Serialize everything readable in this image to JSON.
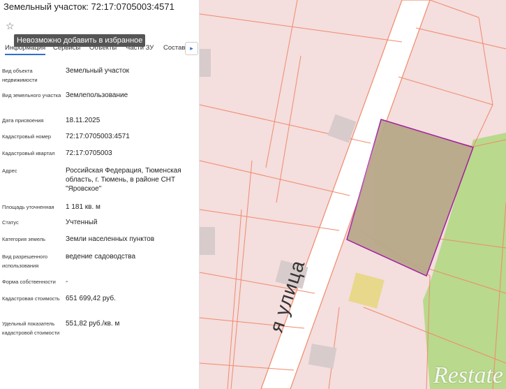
{
  "panel": {
    "title": "Земельный участок: 72:17:0705003:4571",
    "star_icon": "☆",
    "tooltip": "Невозможно добавить в избранное",
    "tabs": [
      "Информация",
      "Сервисы",
      "Объекты",
      "Части ЗУ",
      "Состав"
    ],
    "tab_next": "▸",
    "rows": [
      {
        "label": "Вид объекта недвижимости",
        "value": "Земельный участок"
      },
      {
        "label": "Вид земельного участка",
        "value": "Землепользование"
      },
      {
        "label": "Дата присвоения",
        "value": "18.11.2025"
      },
      {
        "label": "Кадастровый номер",
        "value": "72:17:0705003:4571"
      },
      {
        "label": "Кадастровый квартал",
        "value": "72:17:0705003"
      },
      {
        "label": "Адрес",
        "value": "Российская Федерация, Тюменская область, г. Тюмень, в районе СНТ \"Яровское\""
      },
      {
        "label": "Площадь уточненная",
        "value": "1 181 кв. м"
      },
      {
        "label": "Статус",
        "value": "Учтенный"
      },
      {
        "label": "Категория земель",
        "value": "Земли населенных пунктов"
      },
      {
        "label": "Вид разрешенного использования",
        "value": "ведение садоводства"
      },
      {
        "label": "Форма собственности",
        "value": "-"
      },
      {
        "label": "Кадастровая стоимость",
        "value": "651 699,42 руб."
      },
      {
        "label": "Удельный показатель кадастровой стоимости",
        "value": "551,82 руб./кв. м"
      }
    ]
  },
  "map": {
    "road_label": "я улица",
    "watermark": "Restate",
    "colors": {
      "background": "#f4dede",
      "boundary": "#f08a6a",
      "selected_fill": "#b8a88a",
      "selected_border": "#a020a0",
      "green": "#b9d98c",
      "road": "#ffffff",
      "building": "#d7cbcb",
      "yellow": "#e8d88c"
    }
  }
}
